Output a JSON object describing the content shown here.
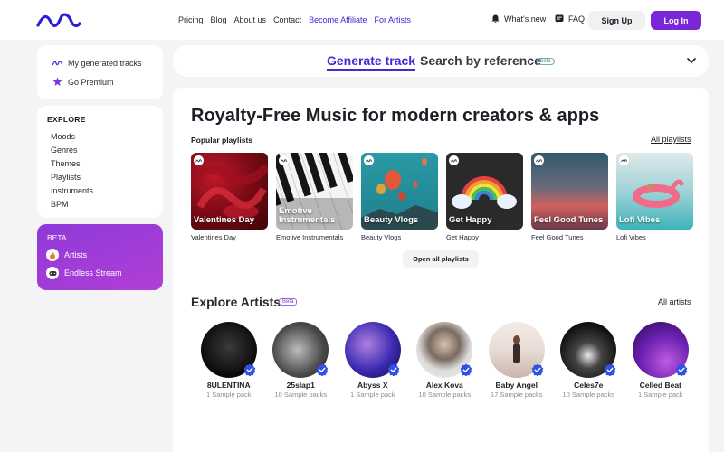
{
  "nav": {
    "links": [
      "Pricing",
      "Blog",
      "About us",
      "Contact",
      "Become Affiliate",
      "For Artists"
    ],
    "whats_new": "What's new",
    "faq": "FAQ",
    "signup": "Sign Up",
    "login": "Log In"
  },
  "sidebar": {
    "my_tracks": "My generated tracks",
    "go_premium": "Go Premium",
    "explore_heading": "EXPLORE",
    "explore_items": [
      "Moods",
      "Genres",
      "Themes",
      "Playlists",
      "Instruments",
      "BPM"
    ],
    "beta_heading": "BETA",
    "beta_items": [
      "Artists",
      "Endless Stream"
    ]
  },
  "genbar": {
    "tab_generate": "Generate track",
    "tab_reference": "Search by reference",
    "beta": "beta"
  },
  "main": {
    "title": "Royalty-Free Music for modern creators & apps",
    "popular_label": "Popular playlists",
    "all_playlists": "All playlists",
    "open_all": "Open all playlists",
    "artists_title": "Explore Artists",
    "artists_beta": "Beta",
    "all_artists": "All artists"
  },
  "playlists": [
    {
      "overlay": "Valentines Day",
      "caption": "Valentines Day"
    },
    {
      "overlay": "Emotive Instrumentals",
      "caption": "Emotive Instrumentals"
    },
    {
      "overlay": "Beauty Vlogs",
      "caption": "Beauty Vlogs"
    },
    {
      "overlay": "Get Happy",
      "caption": "Get Happy"
    },
    {
      "overlay": "Feel Good Tunes",
      "caption": "Feel Good Tunes"
    },
    {
      "overlay": "Lofi Vibes",
      "caption": "Lofi Vibes"
    }
  ],
  "artists": [
    {
      "name": "8ULENTINA",
      "packs": "1 Sample pack"
    },
    {
      "name": "25slap1",
      "packs": "10 Sample packs"
    },
    {
      "name": "Abyss X",
      "packs": "1 Sample pack"
    },
    {
      "name": "Alex Kova",
      "packs": "10 Sample packs"
    },
    {
      "name": "Baby Angel",
      "packs": "17 Sample packs"
    },
    {
      "name": "Celes7e",
      "packs": "10 Sample packs"
    },
    {
      "name": "Celled Beat",
      "packs": "1 Sample pack"
    }
  ],
  "colors": {
    "brand": "#7a26d9",
    "accent_link": "#3b2ad6",
    "verified": "#2f52e6"
  }
}
